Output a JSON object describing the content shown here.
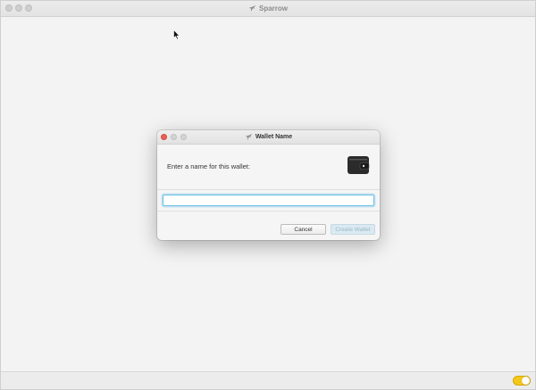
{
  "app": {
    "title": "Sparrow",
    "icon": "sparrow-bird-icon",
    "toggle_state": "on",
    "toggle_color": "#f4c817"
  },
  "dialog": {
    "title": "Wallet Name",
    "prompt": "Enter a name for this wallet:",
    "header_icon": "wallet-icon",
    "name_input": {
      "value": "",
      "placeholder": ""
    },
    "cancel_label": "Cancel",
    "create_label": "Create Wallet",
    "create_enabled": false,
    "focus_color": "#6cbfe6",
    "close_color": "#ec5f56"
  }
}
